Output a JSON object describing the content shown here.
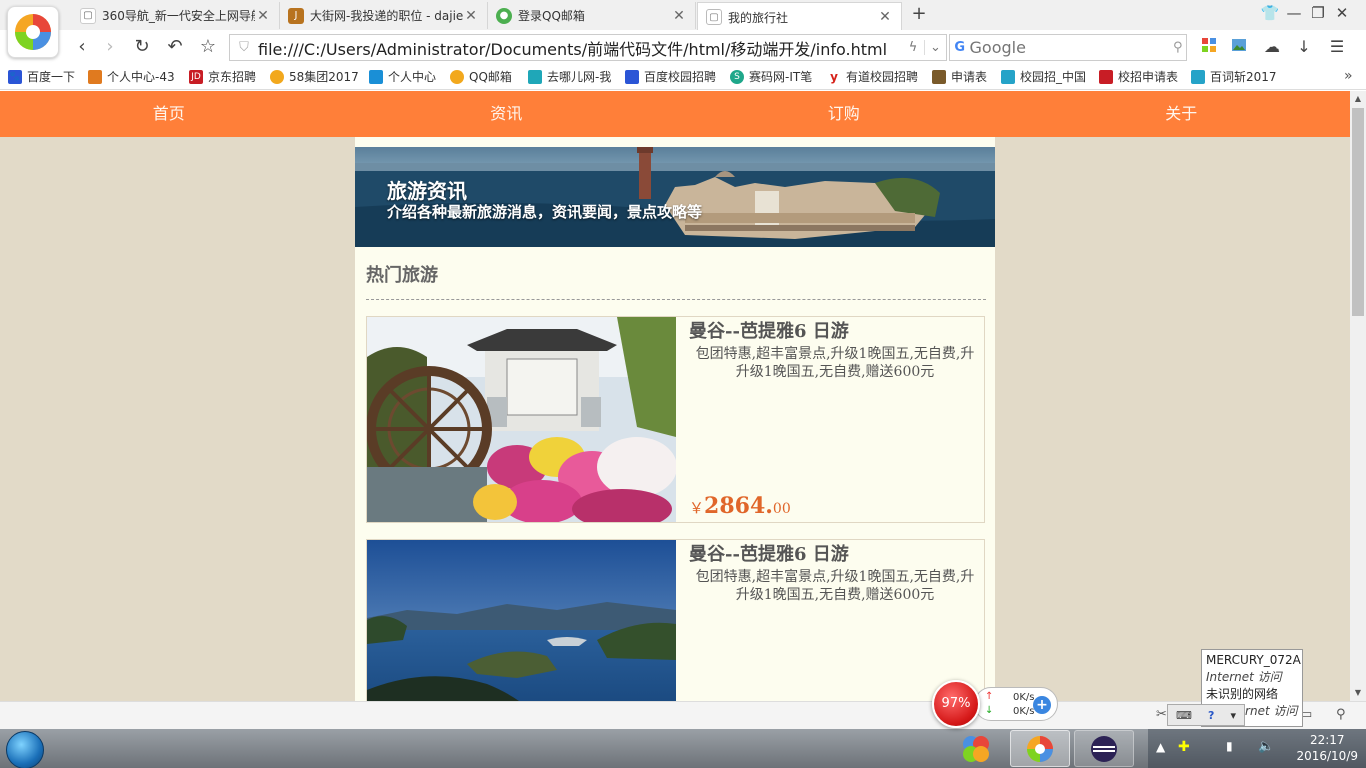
{
  "tabs": [
    {
      "title": "360导航_新一代安全上网导航",
      "active": false
    },
    {
      "title": "大街网-我投递的职位 - dajie",
      "active": false
    },
    {
      "title": "登录QQ邮箱",
      "active": false
    },
    {
      "title": "我的旅行社",
      "active": true
    }
  ],
  "address": {
    "url": "file:///C:/Users/Administrator/Documents/前端代码文件/html/移动端开发/info.html",
    "search_placeholder": "Google"
  },
  "bookmarks": [
    {
      "label": "百度一下",
      "color": "#2b55d6"
    },
    {
      "label": "个人中心-43",
      "color": "#e07a1f"
    },
    {
      "label": "京东招聘",
      "color": "#c81d25"
    },
    {
      "label": "58集团2017",
      "color": "#f2a81d"
    },
    {
      "label": "个人中心",
      "color": "#1a8fd6"
    },
    {
      "label": "QQ邮箱",
      "color": "#f2a81d"
    },
    {
      "label": "去哪儿网-我",
      "color": "#1fa7b8"
    },
    {
      "label": "百度校园招聘",
      "color": "#2b55d6"
    },
    {
      "label": "赛码网-IT笔",
      "color": "#1fa78a"
    },
    {
      "label": "有道校园招聘",
      "color": "#d6221a"
    },
    {
      "label": "申请表",
      "color": "#7a5a2a"
    },
    {
      "label": "校园招_中国",
      "color": "#25a3c8"
    },
    {
      "label": "校招申请表",
      "color": "#c81d25"
    },
    {
      "label": "百词斩2017",
      "color": "#25a3c8"
    }
  ],
  "site": {
    "nav": [
      "首页",
      "资讯",
      "订购",
      "关于"
    ],
    "banner": {
      "title": "旅游资讯",
      "subtitle": "介绍各种最新旅游消息，资讯要闻，景点攻略等"
    },
    "section_title": "热门旅游",
    "products": [
      {
        "name": "曼谷--芭提雅6  日游",
        "desc": "包团特惠,超丰富景点,升级1晚国五,无自费,升升级1晚国五,无自费,赠送600元",
        "price_currency": "￥",
        "price_int": "2864.",
        "price_dec": "00",
        "image": "lijiang-waterwheel"
      },
      {
        "name": "曼谷--芭提雅6  日游",
        "desc": "包团特惠,超丰富景点,升级1晚国五,无自费,升升级1晚国五,无自费,赠送600元",
        "price_currency": "",
        "price_int": "",
        "price_dec": "",
        "image": "lugu-lake"
      }
    ]
  },
  "overlays": {
    "speed_percent": "97%",
    "upload": "0K/s",
    "download": "0K/s",
    "net_tip": {
      "line1": "MERCURY_072A",
      "line2": "Internet 访问",
      "line3": "未识别的网络",
      "line4": "无 Internet 访问"
    }
  },
  "clock": {
    "time": "22:17",
    "date": "2016/10/9"
  },
  "colors": {
    "nav_orange": "#ff7f39",
    "page_bg": "#e2dac8",
    "content_bg": "#fdfdef",
    "price": "#e0662a"
  }
}
